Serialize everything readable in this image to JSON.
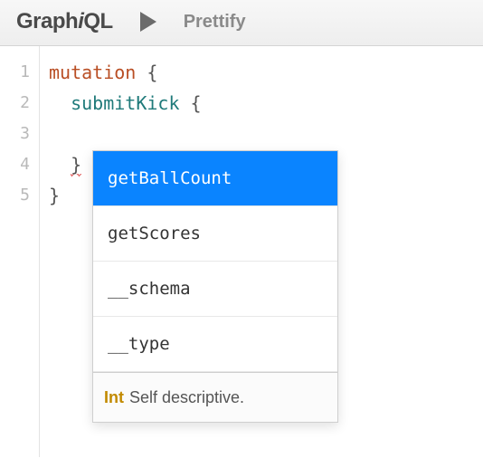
{
  "toolbar": {
    "logo": "GraphiQL",
    "prettify_label": "Prettify"
  },
  "gutter": {
    "lines": [
      "1",
      "2",
      "3",
      "4",
      "5"
    ]
  },
  "code": {
    "line1": {
      "keyword": "mutation",
      "brace": " {"
    },
    "line2": {
      "indent": "  ",
      "field": "submitKick",
      "brace": " {"
    },
    "line3": "",
    "line4": {
      "indent": "  ",
      "brace": "}"
    },
    "line5": {
      "brace": "}"
    }
  },
  "autocomplete": {
    "items": [
      {
        "label": "getBallCount",
        "selected": true
      },
      {
        "label": "getScores",
        "selected": false
      },
      {
        "label": "__schema",
        "selected": false
      },
      {
        "label": "__type",
        "selected": false
      }
    ],
    "hint_type": "Int",
    "hint_desc": "Self descriptive."
  }
}
